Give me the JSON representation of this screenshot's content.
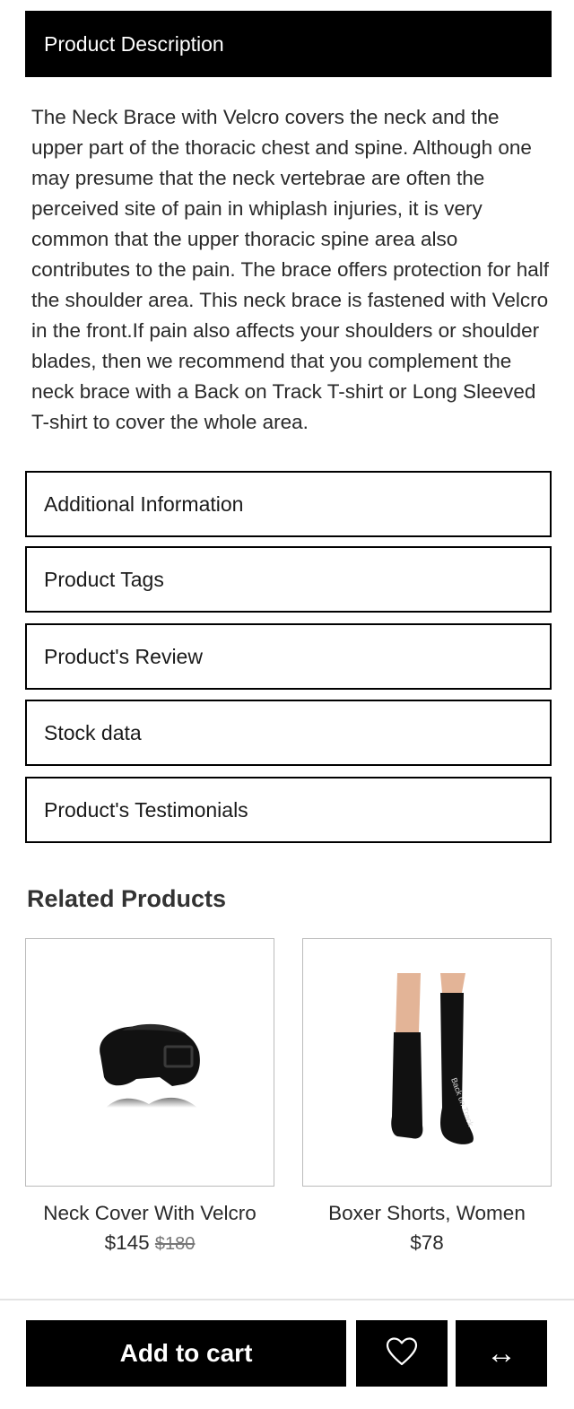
{
  "tabs": {
    "description_title": "Product Description",
    "description_text": "The Neck Brace with Velcro covers the neck and the upper part of the thoracic chest and spine. Although one may presume that the neck vertebrae are often the perceived site of pain in whiplash injuries, it is very common that the upper thoracic spine area also contributes to the pain. The brace offers protection for half the shoulder area. This neck brace is fastened with Velcro in the front.If pain also affects your shoulders or shoulder blades, then we recommend that you complement the neck brace with a Back on Track T-shirt or Long Sleeved T-shirt to cover the whole area.",
    "additional_info": "Additional Information",
    "tags": "Product Tags",
    "review": "Product's Review",
    "stock": "Stock data",
    "testimonials": "Product's Testimonials"
  },
  "related": {
    "title": "Related Products",
    "items": [
      {
        "name": "Neck Cover With Velcro",
        "price": "$145",
        "old_price": "$180",
        "image": "neck-cover-image"
      },
      {
        "name": "Boxer Shorts, Women",
        "price": "$78",
        "old_price": "",
        "image": "socks-image"
      }
    ]
  },
  "actions": {
    "add_to_cart": "Add to cart",
    "wishlist_icon": "heart-icon",
    "compare_icon": "left-right-arrow-icon",
    "compare_glyph": "↔"
  },
  "colors": {
    "primary": "#000000",
    "text": "#2a2a2a",
    "border": "#bbbbbb"
  }
}
